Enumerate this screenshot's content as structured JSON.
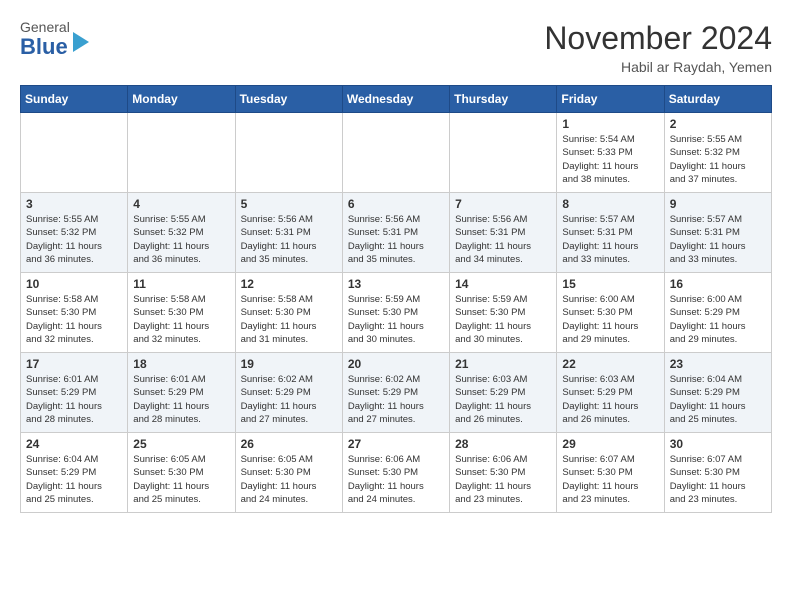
{
  "header": {
    "logo": {
      "general": "General",
      "blue": "Blue"
    },
    "title": "November 2024",
    "location": "Habil ar Raydah, Yemen"
  },
  "weekdays": [
    "Sunday",
    "Monday",
    "Tuesday",
    "Wednesday",
    "Thursday",
    "Friday",
    "Saturday"
  ],
  "weeks": [
    [
      {
        "day": "",
        "info": ""
      },
      {
        "day": "",
        "info": ""
      },
      {
        "day": "",
        "info": ""
      },
      {
        "day": "",
        "info": ""
      },
      {
        "day": "",
        "info": ""
      },
      {
        "day": "1",
        "info": "Sunrise: 5:54 AM\nSunset: 5:33 PM\nDaylight: 11 hours\nand 38 minutes."
      },
      {
        "day": "2",
        "info": "Sunrise: 5:55 AM\nSunset: 5:32 PM\nDaylight: 11 hours\nand 37 minutes."
      }
    ],
    [
      {
        "day": "3",
        "info": "Sunrise: 5:55 AM\nSunset: 5:32 PM\nDaylight: 11 hours\nand 36 minutes."
      },
      {
        "day": "4",
        "info": "Sunrise: 5:55 AM\nSunset: 5:32 PM\nDaylight: 11 hours\nand 36 minutes."
      },
      {
        "day": "5",
        "info": "Sunrise: 5:56 AM\nSunset: 5:31 PM\nDaylight: 11 hours\nand 35 minutes."
      },
      {
        "day": "6",
        "info": "Sunrise: 5:56 AM\nSunset: 5:31 PM\nDaylight: 11 hours\nand 35 minutes."
      },
      {
        "day": "7",
        "info": "Sunrise: 5:56 AM\nSunset: 5:31 PM\nDaylight: 11 hours\nand 34 minutes."
      },
      {
        "day": "8",
        "info": "Sunrise: 5:57 AM\nSunset: 5:31 PM\nDaylight: 11 hours\nand 33 minutes."
      },
      {
        "day": "9",
        "info": "Sunrise: 5:57 AM\nSunset: 5:31 PM\nDaylight: 11 hours\nand 33 minutes."
      }
    ],
    [
      {
        "day": "10",
        "info": "Sunrise: 5:58 AM\nSunset: 5:30 PM\nDaylight: 11 hours\nand 32 minutes."
      },
      {
        "day": "11",
        "info": "Sunrise: 5:58 AM\nSunset: 5:30 PM\nDaylight: 11 hours\nand 32 minutes."
      },
      {
        "day": "12",
        "info": "Sunrise: 5:58 AM\nSunset: 5:30 PM\nDaylight: 11 hours\nand 31 minutes."
      },
      {
        "day": "13",
        "info": "Sunrise: 5:59 AM\nSunset: 5:30 PM\nDaylight: 11 hours\nand 30 minutes."
      },
      {
        "day": "14",
        "info": "Sunrise: 5:59 AM\nSunset: 5:30 PM\nDaylight: 11 hours\nand 30 minutes."
      },
      {
        "day": "15",
        "info": "Sunrise: 6:00 AM\nSunset: 5:30 PM\nDaylight: 11 hours\nand 29 minutes."
      },
      {
        "day": "16",
        "info": "Sunrise: 6:00 AM\nSunset: 5:29 PM\nDaylight: 11 hours\nand 29 minutes."
      }
    ],
    [
      {
        "day": "17",
        "info": "Sunrise: 6:01 AM\nSunset: 5:29 PM\nDaylight: 11 hours\nand 28 minutes."
      },
      {
        "day": "18",
        "info": "Sunrise: 6:01 AM\nSunset: 5:29 PM\nDaylight: 11 hours\nand 28 minutes."
      },
      {
        "day": "19",
        "info": "Sunrise: 6:02 AM\nSunset: 5:29 PM\nDaylight: 11 hours\nand 27 minutes."
      },
      {
        "day": "20",
        "info": "Sunrise: 6:02 AM\nSunset: 5:29 PM\nDaylight: 11 hours\nand 27 minutes."
      },
      {
        "day": "21",
        "info": "Sunrise: 6:03 AM\nSunset: 5:29 PM\nDaylight: 11 hours\nand 26 minutes."
      },
      {
        "day": "22",
        "info": "Sunrise: 6:03 AM\nSunset: 5:29 PM\nDaylight: 11 hours\nand 26 minutes."
      },
      {
        "day": "23",
        "info": "Sunrise: 6:04 AM\nSunset: 5:29 PM\nDaylight: 11 hours\nand 25 minutes."
      }
    ],
    [
      {
        "day": "24",
        "info": "Sunrise: 6:04 AM\nSunset: 5:29 PM\nDaylight: 11 hours\nand 25 minutes."
      },
      {
        "day": "25",
        "info": "Sunrise: 6:05 AM\nSunset: 5:30 PM\nDaylight: 11 hours\nand 25 minutes."
      },
      {
        "day": "26",
        "info": "Sunrise: 6:05 AM\nSunset: 5:30 PM\nDaylight: 11 hours\nand 24 minutes."
      },
      {
        "day": "27",
        "info": "Sunrise: 6:06 AM\nSunset: 5:30 PM\nDaylight: 11 hours\nand 24 minutes."
      },
      {
        "day": "28",
        "info": "Sunrise: 6:06 AM\nSunset: 5:30 PM\nDaylight: 11 hours\nand 23 minutes."
      },
      {
        "day": "29",
        "info": "Sunrise: 6:07 AM\nSunset: 5:30 PM\nDaylight: 11 hours\nand 23 minutes."
      },
      {
        "day": "30",
        "info": "Sunrise: 6:07 AM\nSunset: 5:30 PM\nDaylight: 11 hours\nand 23 minutes."
      }
    ]
  ]
}
